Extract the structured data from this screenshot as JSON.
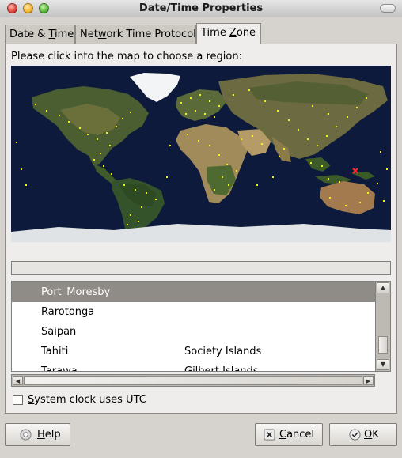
{
  "window": {
    "title": "Date/Time Properties"
  },
  "tabs": [
    {
      "pre": "Date & ",
      "acc": "T",
      "post": "ime"
    },
    {
      "pre": "Net",
      "acc": "w",
      "post": "ork Time Protocol"
    },
    {
      "pre": "Time ",
      "acc": "Z",
      "post": "one"
    }
  ],
  "timezone": {
    "prompt": "Please click into the map to choose a region:",
    "selected_value": "",
    "list": [
      {
        "name": "Port_Moresby",
        "comment": "",
        "selected": true
      },
      {
        "name": "Rarotonga",
        "comment": ""
      },
      {
        "name": "Saipan",
        "comment": ""
      },
      {
        "name": "Tahiti",
        "comment": "Society Islands"
      },
      {
        "name": "Tarawa",
        "comment": "Gilbert Islands"
      }
    ]
  },
  "utc_checkbox": {
    "pre": "",
    "acc": "S",
    "post": "ystem clock uses UTC",
    "checked": false
  },
  "buttons": {
    "help": {
      "pre": "",
      "acc": "H",
      "post": "elp"
    },
    "cancel": {
      "pre": "",
      "acc": "C",
      "post": "ancel"
    },
    "ok": {
      "pre": "",
      "acc": "O",
      "post": "K"
    }
  },
  "colors": {
    "selection": "#8f8b86",
    "ocean": "#0d1a3b",
    "city_marker": "#f4f01e",
    "selected_marker": "#ff2a2a"
  }
}
